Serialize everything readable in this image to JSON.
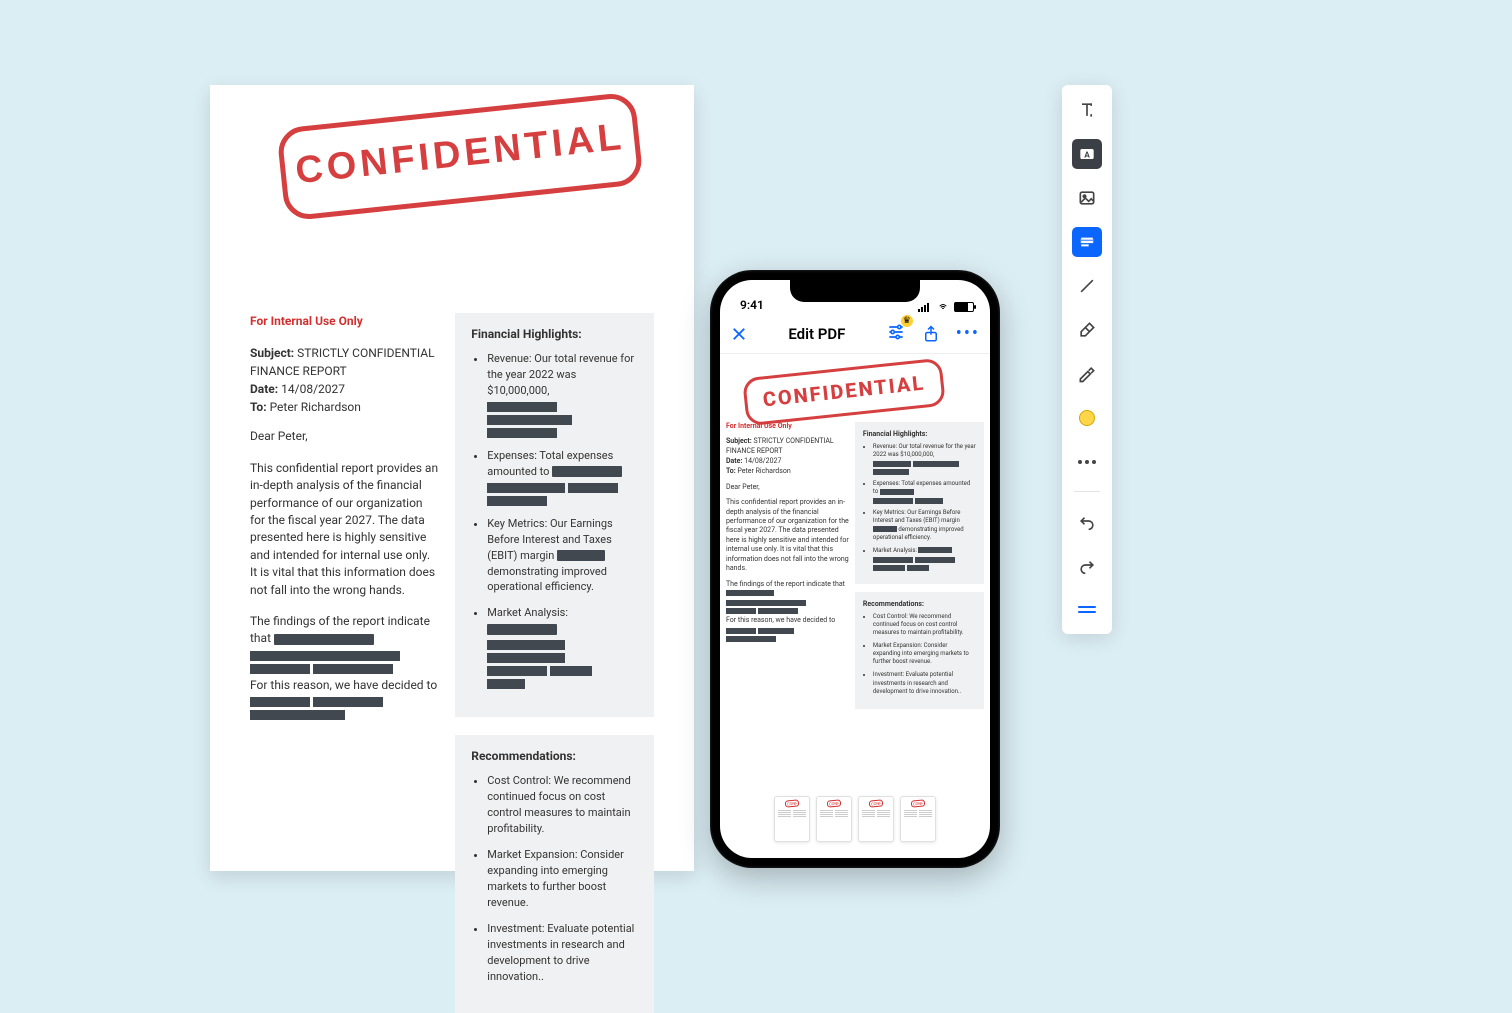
{
  "document": {
    "stamp": "CONFIDENTIAL",
    "internal_label": "For Internal Use Only",
    "subject_label": "Subject:",
    "subject_value": "STRICTLY CONFIDENTIAL FINANCE REPORT",
    "date_label": "Date:",
    "date_value": "14/08/2027",
    "to_label": "To:",
    "to_value": "Peter Richardson",
    "salutation": "Dear Peter,",
    "intro": "This confidential report provides an in-depth analysis of the financial performance of our organization for the fiscal year 2027. The data presented here is highly sensitive and intended for internal use only. It is vital that this information does not fall into the wrong hands.",
    "findings_prefix": "The findings of the report indicate that",
    "findings_middle": "For this reason, we have decided to",
    "highlights_title": "Financial Highlights:",
    "highlights": {
      "revenue": "Revenue: Our total revenue for the year 2022 was $10,000,000,",
      "expenses": "Expenses: Total expenses amounted to",
      "metrics_a": "Key Metrics: Our Earnings Before Interest and Taxes (EBIT) margin",
      "metrics_b": "demonstrating improved operational efficiency.",
      "market": "Market Analysis:"
    },
    "recs_title": "Recommendations:",
    "recs": [
      "Cost Control: We recommend continued focus on cost control measures to maintain profitability.",
      "Market Expansion: Consider expanding into emerging markets to further boost revenue.",
      "Investment: Evaluate potential investments in research and development to drive innovation.."
    ]
  },
  "phone": {
    "time": "9:41",
    "title": "Edit PDF"
  },
  "toolbar": {
    "tools": [
      "text",
      "text-box",
      "image",
      "redact",
      "line",
      "eraser",
      "highlighter",
      "color",
      "more",
      "undo",
      "redo",
      "drag"
    ]
  }
}
